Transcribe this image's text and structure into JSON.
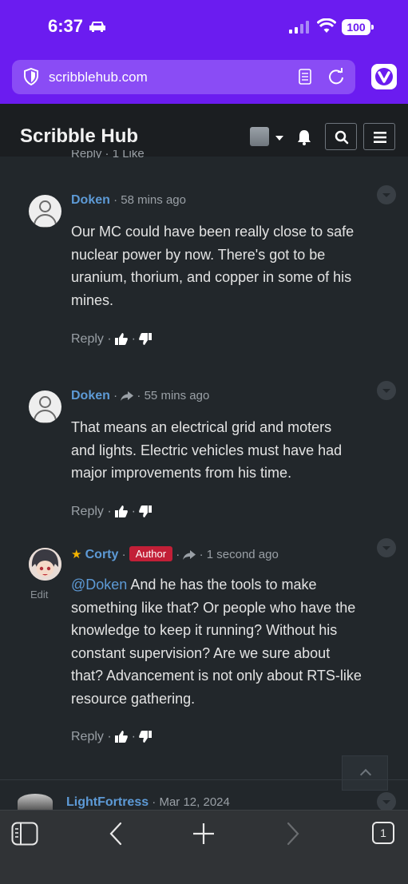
{
  "status_bar": {
    "time": "6:37",
    "battery": "100"
  },
  "browser": {
    "url": "scribblehub.com",
    "open_tabs": "1"
  },
  "site": {
    "title": "Scribble Hub"
  },
  "partial_reply": {
    "label": "Reply",
    "likes": "1 Like"
  },
  "comments": [
    {
      "author": "Doken",
      "time": "58 mins ago",
      "text_lines": [
        "Our MC could have been really close to safe",
        "nuclear power by now. There's got to be",
        "uranium, thorium, and copper in some of his",
        "mines."
      ],
      "reply_label": "Reply"
    },
    {
      "author": "Doken",
      "time": "55 mins ago",
      "text_lines": [
        "That means an electrical grid and moters",
        "and lights. Electric vehicles must have had",
        "major improvements from his time."
      ],
      "reply_label": "Reply"
    },
    {
      "author": "Corty",
      "badge": "Author",
      "time": "1 second ago",
      "edit_label": "Edit",
      "mention": "@Doken",
      "text_lines": [
        " And he has the tools to make",
        "something like that? Or people who have the",
        "knowledge to keep it running? Without his",
        "constant supervision? Are we sure about",
        "that? Advancement is not only about RTS-like",
        "resource gathering."
      ],
      "reply_label": "Reply"
    },
    {
      "author": "LightFortress",
      "time": "Mar 12, 2024"
    }
  ]
}
